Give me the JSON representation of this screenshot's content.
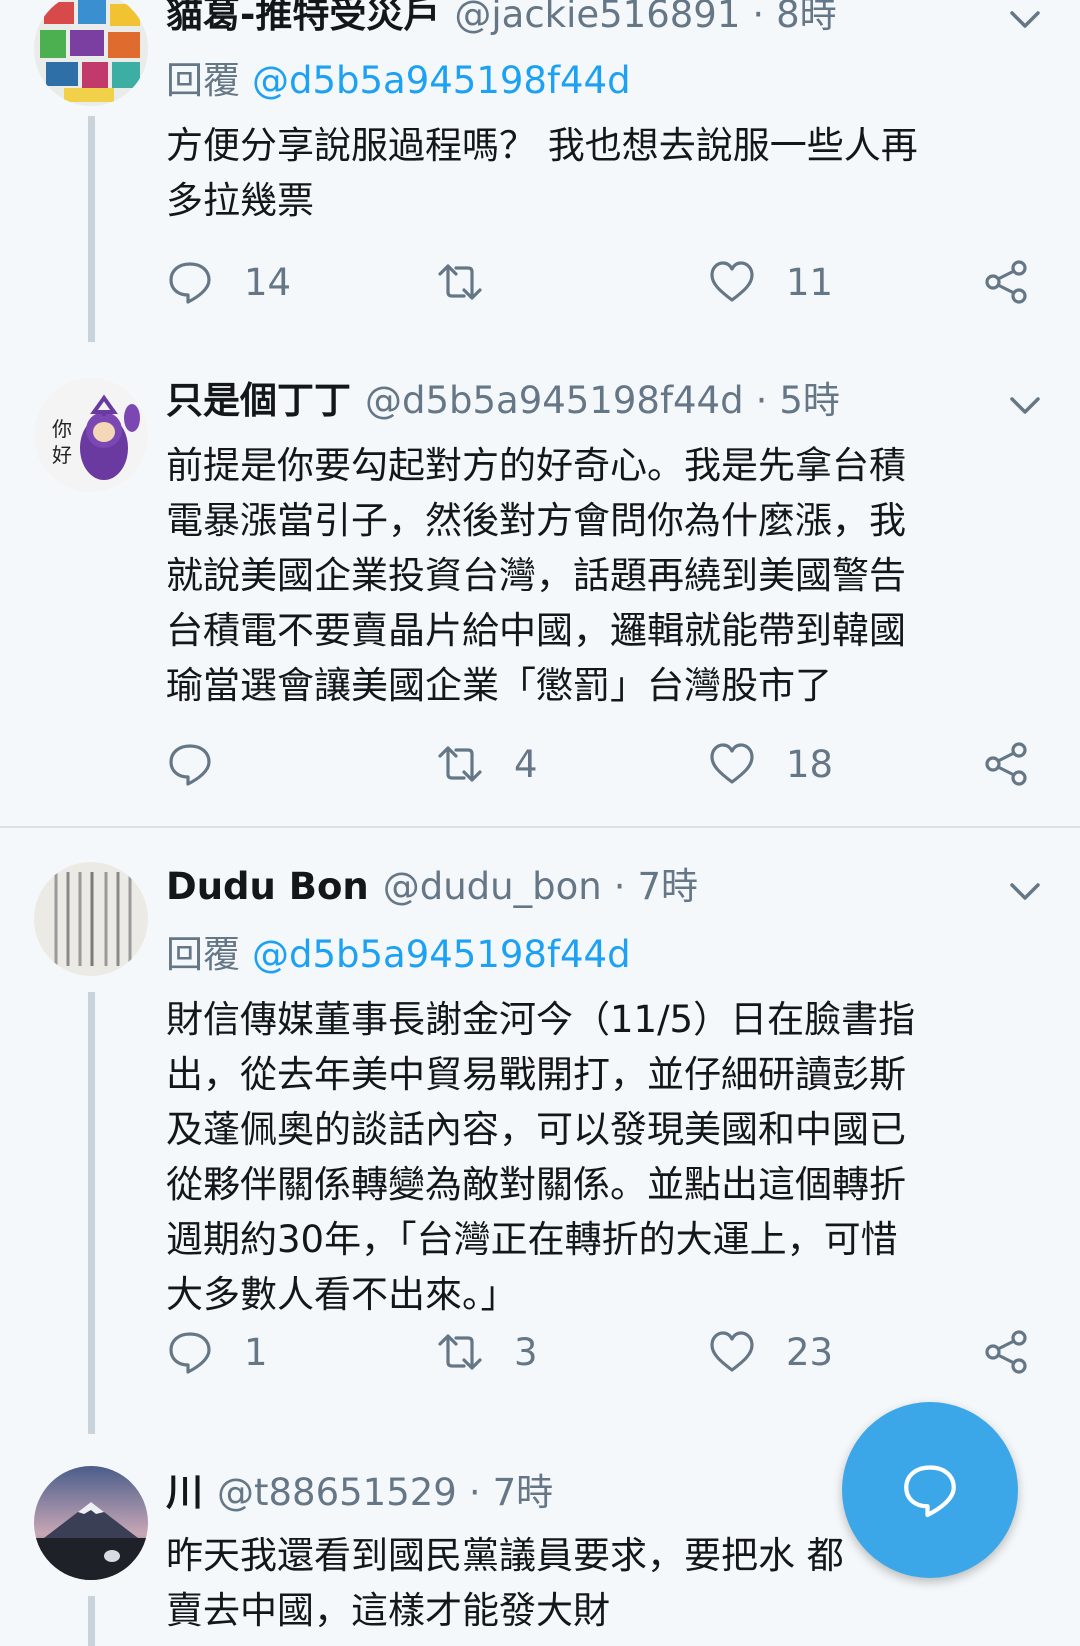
{
  "tweets": [
    {
      "name": "貓葛-推特受災戶",
      "handle": "@jackie516891",
      "time": "8時",
      "reply_label": "回覆",
      "reply_to": "@d5b5a945198f44d",
      "text": "方便分享說服過程嗎？ 我也想去說服一些人再\n多拉幾票",
      "replies": "14",
      "retweets": "",
      "likes": "11"
    },
    {
      "name": "只是個丁丁",
      "handle": "@d5b5a945198f44d",
      "time": "5時",
      "text": "前提是你要勾起對方的好奇心。我是先拿台積\n電暴漲當引子，然後對方會問你為什麼漲，我\n就說美國企業投資台灣，話題再繞到美國警告\n台積電不要賣晶片給中國，邏輯就能帶到韓國\n瑜當選會讓美國企業「懲罰」台灣股市了",
      "replies": "",
      "retweets": "4",
      "likes": "18"
    },
    {
      "name": "Dudu Bon",
      "handle": "@dudu_bon",
      "time": "7時",
      "reply_label": "回覆",
      "reply_to": "@d5b5a945198f44d",
      "text": "財信傳媒董事長謝金河今（11/5）日在臉書指\n出，從去年美中貿易戰開打，並仔細研讀彭斯\n及蓬佩奧的談話內容，可以發現美國和中國已\n從夥伴關係轉變為敵對關係。並點出這個轉折\n週期約30年，「台灣正在轉折的大運上，可惜\n大多數人看不出來。」",
      "replies": "1",
      "retweets": "3",
      "likes": "23"
    },
    {
      "name": "川",
      "handle": "@t88651529",
      "time": "7時",
      "text": "昨天我還看到國民黨議員要求，要把水 都\n賣去中國，這樣才能發大財"
    }
  ],
  "colors": {
    "background": "#f5f8fa",
    "accent": "#1da1f2",
    "muted": "#657786",
    "fab": "#3ba7e8"
  },
  "icons": {
    "reply": "comment-icon",
    "retweet": "retweet-icon",
    "like": "heart-icon",
    "share": "share-icon",
    "menu": "chevron-down-icon",
    "compose": "compose-reply-icon"
  }
}
